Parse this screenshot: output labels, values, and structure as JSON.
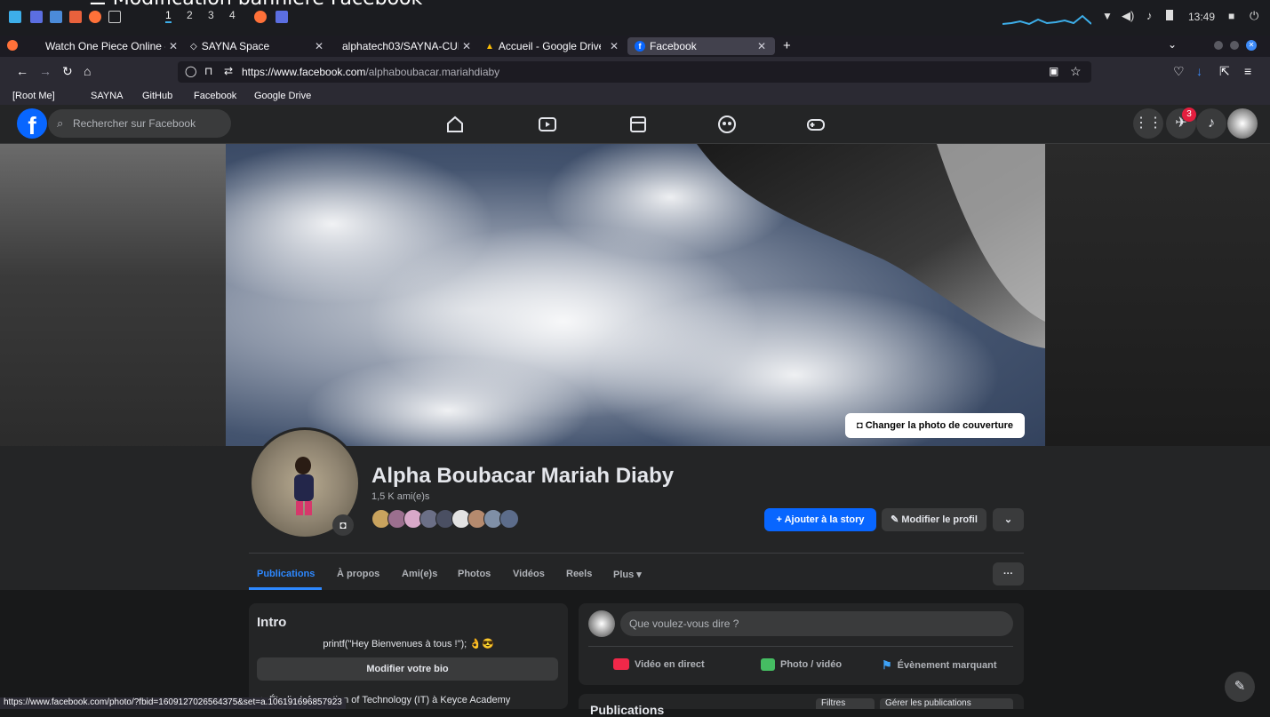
{
  "window": {
    "title": "☰ Modification bannière Facebook"
  },
  "os": {
    "workspaces": [
      "1",
      "2",
      "3",
      "4"
    ],
    "active_workspace": "1",
    "clock": "13:49"
  },
  "browser": {
    "tabs": [
      {
        "label": "Watch One Piece Online -",
        "active": false
      },
      {
        "label": "SAYNA Space",
        "active": false
      },
      {
        "label": "alphatech03/SAYNA-CUL",
        "active": false
      },
      {
        "label": "Accueil - Google Drive",
        "active": false
      },
      {
        "label": "Facebook",
        "active": true
      }
    ],
    "new_tab": "+",
    "url_host": "https://www.facebook.com",
    "url_path": "/alphaboubacar.mariahdiaby",
    "bookmarks": [
      "[Root Me]",
      "SAYNA",
      "GitHub",
      "Facebook",
      "Google Drive"
    ]
  },
  "facebook": {
    "logo": "f",
    "search_placeholder": "Rechercher sur Facebook",
    "messenger_badge": "3",
    "change_cover_label": "Changer la photo de couverture",
    "profile_name": "Alpha Boubacar Mariah Diaby",
    "friend_count": "1,5 K ami(e)s",
    "add_story_label": "+ Ajouter à la story",
    "edit_profile_label": "Modifier le profil",
    "more_chevron": "⌄",
    "tabs": [
      "Publications",
      "À propos",
      "Ami(e)s",
      "Photos",
      "Vidéos",
      "Reels",
      "Plus ▾"
    ],
    "tab_more": "···",
    "intro": {
      "title": "Intro",
      "bio": "printf(\"Hey Bienvenues à tous !\"); 👌😎",
      "edit_bio_label": "Modifier votre bio",
      "study": "Étudie Information of Technology (IT) à Keyce Academy"
    },
    "composer": {
      "placeholder": "Que voulez-vous dire ?",
      "actions": [
        "Vidéo en direct",
        "Photo / vidéo",
        "Évènement marquant"
      ]
    },
    "posts": {
      "title": "Publications",
      "filters_label": "Filtres",
      "manage_label": "Gérer les publications"
    }
  },
  "status_url": "https://www.facebook.com/photo/?fbid=1609127026564375&set=a.106191696857923",
  "colors": {
    "fb_blue": "#0866ff",
    "link_blue": "#2d88ff",
    "card": "#242526",
    "bg": "#18191a",
    "badge_red": "#e41e3f"
  }
}
